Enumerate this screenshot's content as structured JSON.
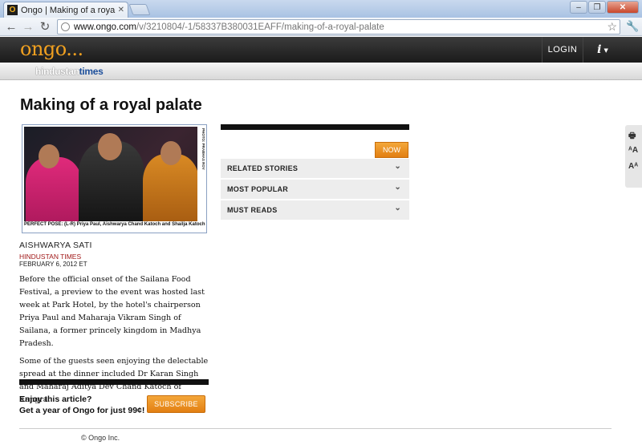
{
  "browser": {
    "tab_title": "Ongo | Making of a royal palate",
    "tab_favicon": "O",
    "url_domain": "www.ongo.com",
    "url_path": "/v/3210804/-1/58337B380031EAFF/making-of-a-royal-palate"
  },
  "site": {
    "logo": "ongo...",
    "login": "LOGIN",
    "info": "i",
    "partner_part1": "hindustan",
    "partner_part2": "times"
  },
  "article": {
    "title": "Making of a royal palate",
    "photo_credit": "PHOTO: PRABHAS ROY",
    "caption": "PERFECT POSE: (L-R) Priya Paul, Aishwarya Chand Katoch and Shailja Katoch",
    "author": "AISHWARYA SATI",
    "source": "HINDUSTAN TIMES",
    "date": "FEBRUARY 6, 2012 ET",
    "paragraphs": [
      "Before the official onset of the Sailana Food Festival, a preview to the event was hosted last week at Park Hotel, by the hotel's chairperson Priya Paul and Maharaja Vikram Singh of Sailana, a former princely kingdom in Madhya Pradesh.",
      "Some of the guests seen enjoying the delectable spread at the dinner included Dr Karan Singh and Maharaj Aditya Dev Chand Katoch of Kangra."
    ],
    "promo_line1": "Enjoy this article?",
    "promo_line2": "Get a year of Ongo for just 99¢!",
    "subscribe": "SUBSCRIBE"
  },
  "sidebar": {
    "now": "NOW",
    "sections": [
      "RELATED STORIES",
      "MOST POPULAR",
      "MUST READS"
    ]
  },
  "footer": {
    "copyright": "© Ongo Inc."
  },
  "colors": {
    "accent_orange": "#e8891a",
    "partner_blue": "#1d4f9b",
    "source_red": "#a01818"
  }
}
